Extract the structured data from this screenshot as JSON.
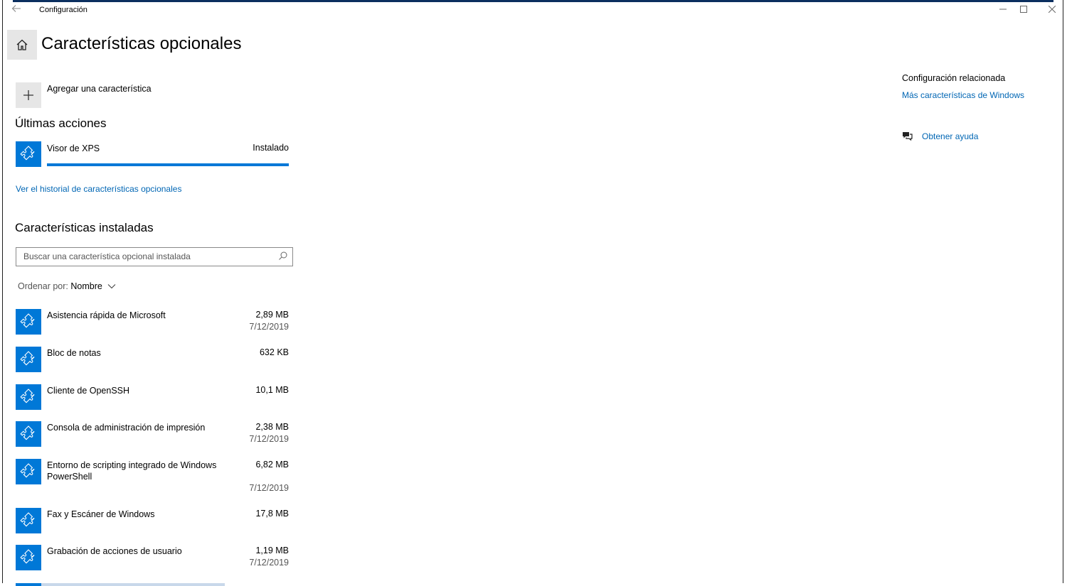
{
  "window": {
    "title": "Configuración",
    "back_icon": "back-arrow-icon",
    "minimize_icon": "minimize-icon",
    "maximize_icon": "maximize-icon",
    "close_icon": "close-icon"
  },
  "header": {
    "title": "Características opcionales",
    "home_icon": "home-icon"
  },
  "add_feature": {
    "label": "Agregar una característica",
    "icon": "plus-icon"
  },
  "recent_actions": {
    "heading": "Últimas acciones",
    "items": [
      {
        "name": "Visor de XPS",
        "status": "Instalado",
        "progress": 1.0
      }
    ],
    "history_link": "Ver el historial de características opcionales"
  },
  "installed": {
    "heading": "Características instaladas",
    "search_placeholder": "Buscar una característica opcional instalada",
    "sort_label": "Ordenar por:",
    "sort_value": "Nombre",
    "items": [
      {
        "name": "Asistencia rápida de Microsoft",
        "size": "2,89 MB",
        "date": "7/12/2019"
      },
      {
        "name": "Bloc de notas",
        "size": "632 KB",
        "date": ""
      },
      {
        "name": "Cliente de OpenSSH",
        "size": "10,1 MB",
        "date": ""
      },
      {
        "name": "Consola de administración de impresión",
        "size": "2,38 MB",
        "date": "7/12/2019"
      },
      {
        "name": "Entorno de scripting integrado de Windows PowerShell",
        "size": "6,82 MB",
        "date": "7/12/2019"
      },
      {
        "name": "Fax y Escáner de Windows",
        "size": "17,8 MB",
        "date": ""
      },
      {
        "name": "Grabación de acciones de usuario",
        "size": "1,19 MB",
        "date": "7/12/2019"
      }
    ]
  },
  "related": {
    "heading": "Configuración relacionada",
    "link": "Más características de Windows",
    "help_link": "Obtener ayuda"
  },
  "colors": {
    "accent": "#0078d7",
    "link": "#0066b4"
  }
}
